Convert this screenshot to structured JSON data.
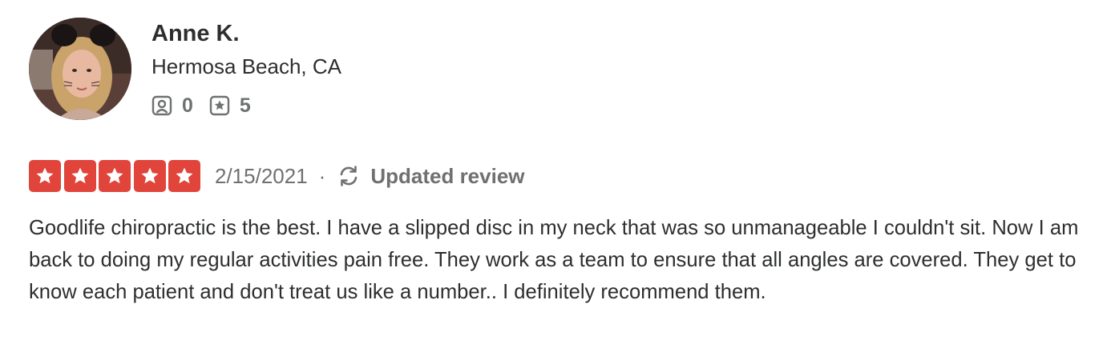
{
  "reviewer": {
    "name": "Anne K.",
    "location": "Hermosa Beach, CA",
    "friends_count": "0",
    "reviews_count": "5",
    "friends_icon": "friends-icon",
    "reviews_icon": "review-star-icon"
  },
  "review": {
    "rating": 5,
    "date": "2/15/2021",
    "separator": "·",
    "updated_label": "Updated review",
    "updated_icon": "refresh-icon",
    "text": "Goodlife chiropractic is the best. I have a slipped disc in my neck that was so unmanageable I couldn't sit. Now I am back to doing my regular activities pain free. They work as a team to ensure that all angles are covered. They get to know each patient and don't treat us like a number.. I definitely recommend them."
  },
  "colors": {
    "star_red": "#e0443b",
    "text_dark": "#2d2e2f",
    "text_gray": "#6e7072"
  }
}
